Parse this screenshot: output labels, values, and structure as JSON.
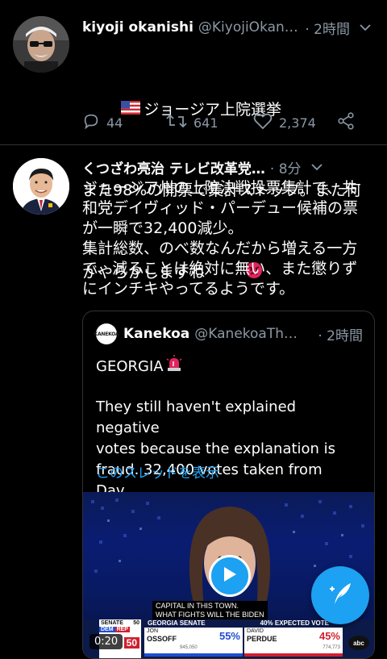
{
  "colors": {
    "background": "#000000",
    "text": "#ffffff",
    "secondary": "#8b98a5",
    "link": "#1da1f2",
    "divider": "#2f3336",
    "angry": "#e0245e"
  },
  "tweets": [
    {
      "name": "kiyoji okanishi",
      "handle": "@KiyojiOkan…",
      "time": "· 2時間",
      "flag_icon": "us-flag-icon",
      "text_line1": "ジョージア上院選挙",
      "text_line2": "また98%の開票で集計ストップ。また何",
      "text_line3": "かやらかしますね",
      "emoji_icon": "angry-face-icon",
      "replies": "44",
      "retweets": "641",
      "likes": "2,374"
    },
    {
      "name": "くつざわ亮治 テレビ改革党…",
      "time": "· 8分",
      "text": "ジョージア州の上院決戦投票集計で、共\n和党デイヴィッド・パーデュー候補の票\nが一瞬で32,400減少。\n集計総数、のべ数なんだから増える一方\nで、減ることは絶対に無い、また懲りず\nにインチキやってるようです。",
      "quote": {
        "avatar_text": "KANEKOA",
        "name": "Kanekoa",
        "handle": "@KanekoaTh…",
        "time": "· 2時間",
        "line1": "GEORGIA",
        "siren_icon": "siren-icon",
        "line2": "They still haven't explained negative\nvotes because the explanation is\nfraud. 32,400 votes taken from Dav…",
        "show_thread": "このスレッドを表示",
        "video": {
          "caption1": "CAPITAL IN THIS TOWN.",
          "caption2": "WHAT FIGHTS WILL THE BIDEN",
          "duration": "0:20",
          "senate_label": "SENATE",
          "senate_dem": "50",
          "senate_rep": "50",
          "dem_label": "DEM",
          "rep_label": "REP",
          "race_title": "GEORGIA SENATE",
          "expected": "40% EXPECTED VOTE",
          "cand1_first": "JON",
          "cand1_last": "OSSOFF",
          "cand1_pct": "55%",
          "cand1_votes": "945,050",
          "cand2_first": "DAVID",
          "cand2_last": "PERDUE",
          "cand2_pct": "45%",
          "cand2_votes": "774,773",
          "network": "abc"
        }
      }
    }
  ],
  "compose_button": "compose-tweet-button"
}
